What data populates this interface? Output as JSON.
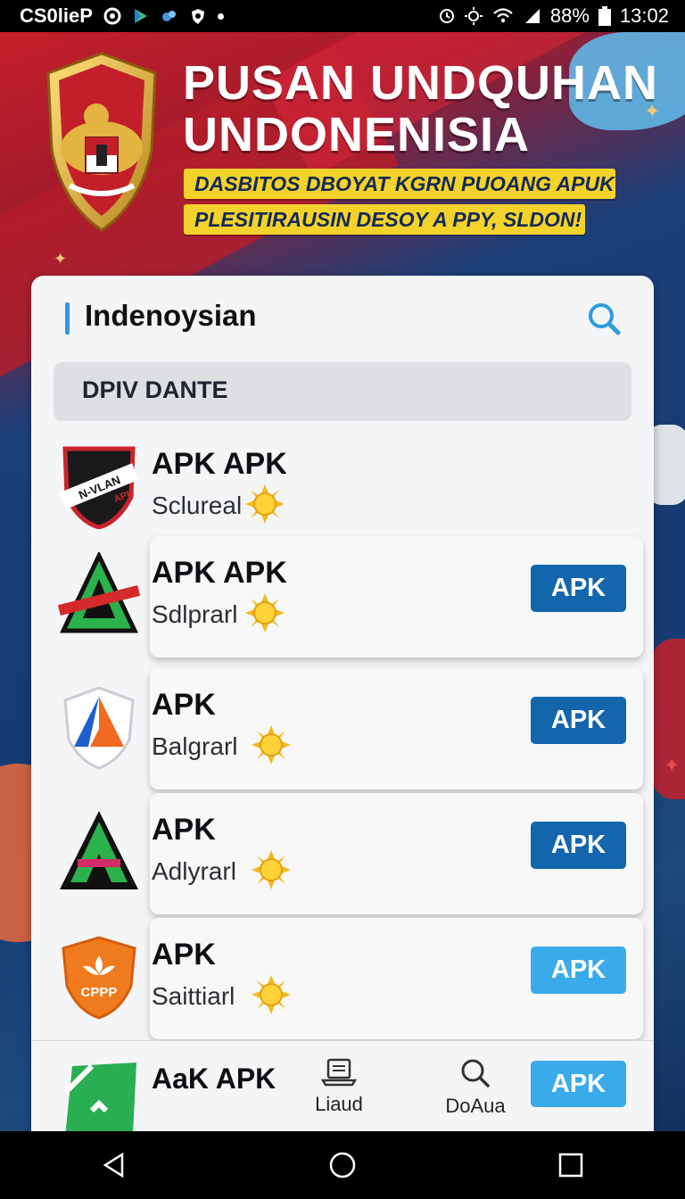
{
  "status_bar": {
    "carrier": "CS0lieP",
    "battery": "88%",
    "time": "13:02"
  },
  "hero": {
    "title_line1": "PUSAN UNDQUHAN",
    "title_line2": "UNDONENISIA",
    "tagline1": "DASBITOS DBOYAT KGRN PUOANG APUK",
    "tagline2": "PLESITIRAUSIN DESOY A PPY, SLDON!"
  },
  "card": {
    "title": "Indenoysian",
    "section_label": "DPIV DANTE"
  },
  "apps": [
    {
      "name": "APK APK",
      "sub": "Sclureal",
      "button": "",
      "icon": "black-red-shield-icon"
    },
    {
      "name": "APK APK",
      "sub": "Sdlprarl",
      "button": "APK",
      "icon": "green-a-icon"
    },
    {
      "name": "APK",
      "sub": "Balgrarl",
      "button": "APK",
      "icon": "blue-orange-shield-icon"
    },
    {
      "name": "APK",
      "sub": "Adlyrarl",
      "button": "APK",
      "icon": "green-black-a-icon"
    },
    {
      "name": "APK",
      "sub": "Saittiarl",
      "button": "APK",
      "icon": "orange-cppp-shield-icon"
    }
  ],
  "bottom_nav": {
    "app_name": "AaK APK",
    "item1": "Liaud",
    "item2": "DoAua",
    "button": "APK"
  },
  "colors": {
    "primary_button": "#1466ac",
    "light_button": "#3aabea",
    "accent_bar": "#2f9ae0",
    "tag_yellow": "#f4d22c"
  }
}
